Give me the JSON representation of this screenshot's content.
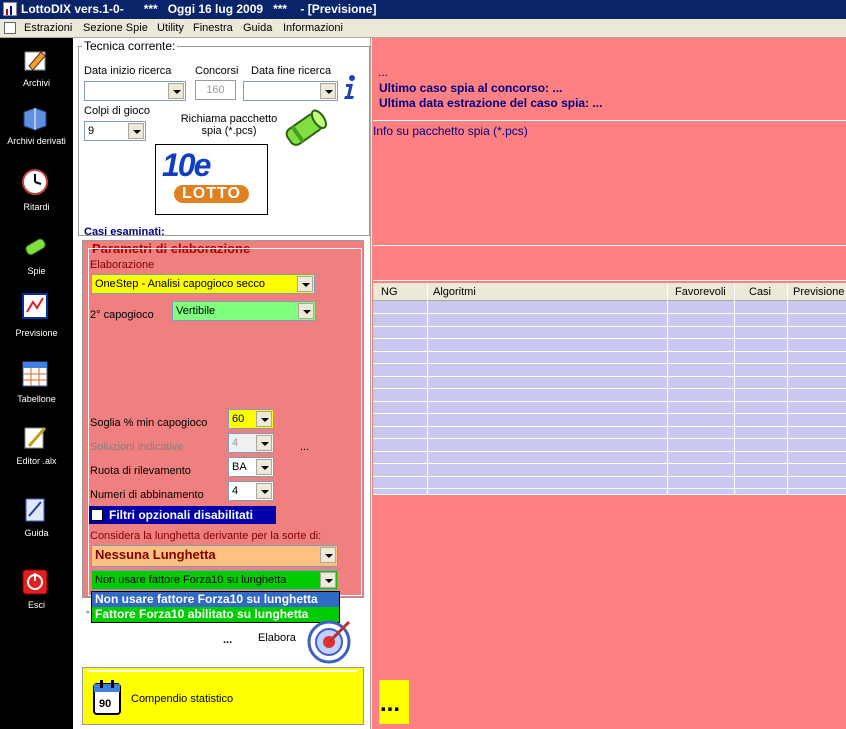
{
  "window": {
    "title": "LottoDIX vers.1-0-      ***   Oggi 16 lug 2009   ***    - [Previsione]"
  },
  "menu": [
    "Estrazioni",
    "Sezione Spie",
    "Utility",
    "Finestra",
    "Guida",
    "Informazioni"
  ],
  "sidebar": [
    {
      "label": "Archivi",
      "icon": "pencil-icon"
    },
    {
      "label": "Archivi derivati",
      "icon": "book-icon"
    },
    {
      "label": "Ritardi",
      "icon": "clock-icon"
    },
    {
      "label": "Spie",
      "icon": "flashlight-icon"
    },
    {
      "label": "Previsione",
      "icon": "chart-icon"
    },
    {
      "label": "Tabellone",
      "icon": "grid-icon"
    },
    {
      "label": "Editor .alx",
      "icon": "editor-icon"
    },
    {
      "label": "Guida",
      "icon": "guide-icon"
    },
    {
      "label": "Esci",
      "icon": "exit-icon"
    }
  ],
  "left": {
    "tecnica_legend": "Tecnica corrente:",
    "data_inizio_label": "Data inizio ricerca",
    "data_inizio_value": "",
    "concorsi_label": "Concorsi",
    "concorsi_value": "160",
    "data_fine_label": "Data fine ricerca",
    "data_fine_value": "",
    "colpi_label": "Colpi di gioco",
    "colpi_value": "9",
    "richiama_label": "Richiama pacchetto spia (*.pcs)",
    "logo_text_top": "10e",
    "logo_text_bottom": "LOTTO",
    "casi_label": "Casi esaminati:"
  },
  "param": {
    "legend": "Parametri di elaborazione",
    "elaborazione_label": "Elaborazione",
    "elaborazione_value": "OneStep - Analisi capogioco secco",
    "capogioco2_label": "2° capogioco",
    "capogioco2_value": "Vertibile",
    "soglia_label": "Soglia % min capogioco",
    "soglia_value": "60",
    "soluzioni_label": "Soluzioni indicative",
    "soluzioni_value": "4",
    "soluzioni_extra": "...",
    "ruota_label": "Ruota di rilevamento",
    "ruota_value": "BA",
    "numeri_label": "Numeri di abbinamento",
    "numeri_value": "4",
    "filtri_label": "Filtri opzionali disabilitati",
    "considera_label": "Considera la lunghetta derivante per la sorte di:",
    "lunghetta_value": "Nessuna Lunghetta",
    "forza_value": "Non usare fattore Forza10 su lunghetta",
    "dropdown_options": [
      "Non usare fattore Forza10 su lunghetta",
      "Fattore Forza10 abilitato su lunghetta"
    ]
  },
  "bottom": {
    "dots": "...",
    "elabora_label": "Elabora",
    "compendio_label": "Compendio statistico",
    "calendar_number": "90"
  },
  "right": {
    "dots_top": "...",
    "ultimo_caso": "Ultimo caso spia al concorso:  ...",
    "ultima_data": "Ultima data estrazione del caso spia:  ...",
    "info_label": "Info su pacchetto spia (*.pcs)",
    "columns": [
      "NG",
      "Algoritmi",
      "Favorevoli",
      "Casi",
      "Previsione"
    ],
    "bottom_dots": "..."
  },
  "colors": {
    "title_bg": "#0a246a",
    "panel_red": "#ff8080",
    "param_red": "#f08080",
    "grid_row": "#c8c8f0",
    "yellow": "#ffff00",
    "green_combo": "#80ff80",
    "orange_combo": "#ffc080",
    "select_blue": "#316ac5",
    "option_green": "#00cc00",
    "filtri_bg": "#0000aa"
  }
}
